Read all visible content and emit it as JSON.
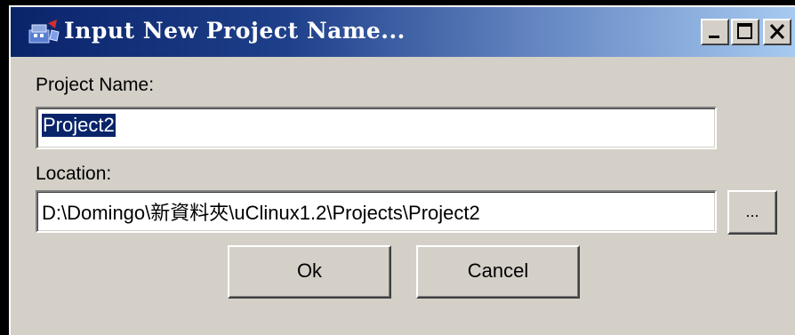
{
  "window": {
    "title": "Input New Project Name...",
    "app_icon": "project-app-icon",
    "controls": {
      "minimize": "minimize-icon",
      "maximize": "maximize-icon",
      "close": "close-icon"
    }
  },
  "form": {
    "project_name_label": "Project Name:",
    "project_name_value": "Project2",
    "location_label": "Location:",
    "location_value": "D:\\Domingo\\新資料夾\\uClinux1.2\\Projects\\Project2",
    "browse_label": "..."
  },
  "buttons": {
    "ok": "Ok",
    "cancel": "Cancel"
  },
  "colors": {
    "title_bar_start": "#0a246a",
    "title_bar_end": "#a6caf0",
    "dialog_face": "#d4d0c8",
    "selection": "#0a246a"
  }
}
